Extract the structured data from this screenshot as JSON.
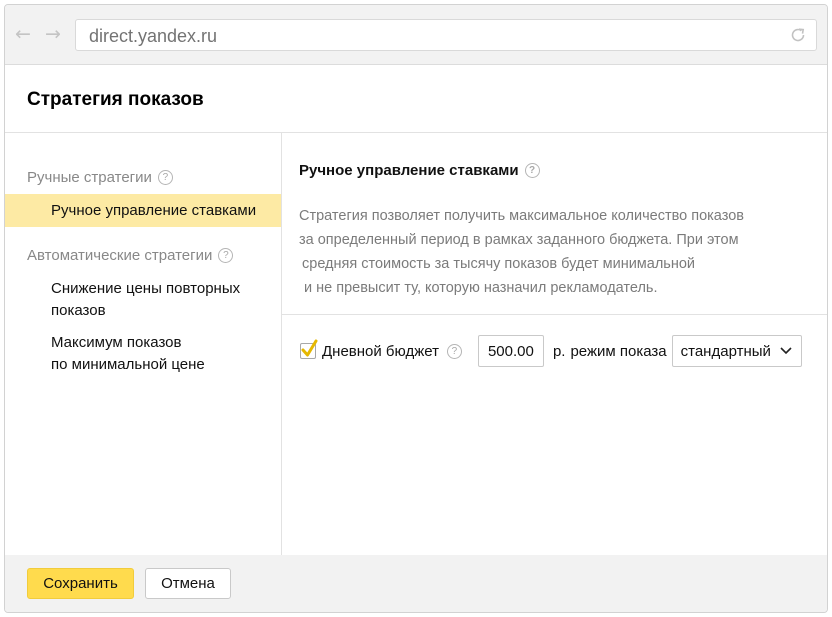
{
  "browser": {
    "url": "direct.yandex.ru",
    "back_glyph": "←",
    "forward_glyph": "→"
  },
  "dialog": {
    "title": "Стратегия показов"
  },
  "sidebar": {
    "groups": [
      {
        "label": "Ручные стратегии",
        "items": [
          {
            "label": "Ручное управление ставками",
            "active": true
          }
        ]
      },
      {
        "label": "Автоматические стратегии",
        "items": [
          {
            "label_lines": [
              "Снижение цены повторных",
              "показов"
            ],
            "active": false
          },
          {
            "label_lines": [
              "Максимум показов",
              "по минимальной цене"
            ],
            "active": false
          }
        ]
      }
    ]
  },
  "main": {
    "title": "Ручное управление ставками",
    "description_lines": [
      "Стратегия позволяет получить максимальное количество показов",
      "за определенный период в рамках заданного бюджета. При этом",
      "средняя стоимость за тысячу показов будет минимальной",
      "и не превысит ту, которую назначил рекламодатель."
    ],
    "budget": {
      "checked": true,
      "label": "Дневной бюджет",
      "value": "500.00",
      "currency": "р.",
      "mode_label": "режим показа",
      "mode_selected": "стандартный"
    }
  },
  "footer": {
    "save_label": "Сохранить",
    "cancel_label": "Отмена"
  },
  "help_glyph": "?",
  "colors": {
    "active_item_bg": "#fdeaa4",
    "primary_button": "#ffdb4d",
    "checkmark": "#e6b800"
  },
  "icons": [
    "arrow-left-icon",
    "arrow-right-icon",
    "reload-icon",
    "help-icon",
    "checkmark-icon",
    "chevron-down-icon"
  ]
}
